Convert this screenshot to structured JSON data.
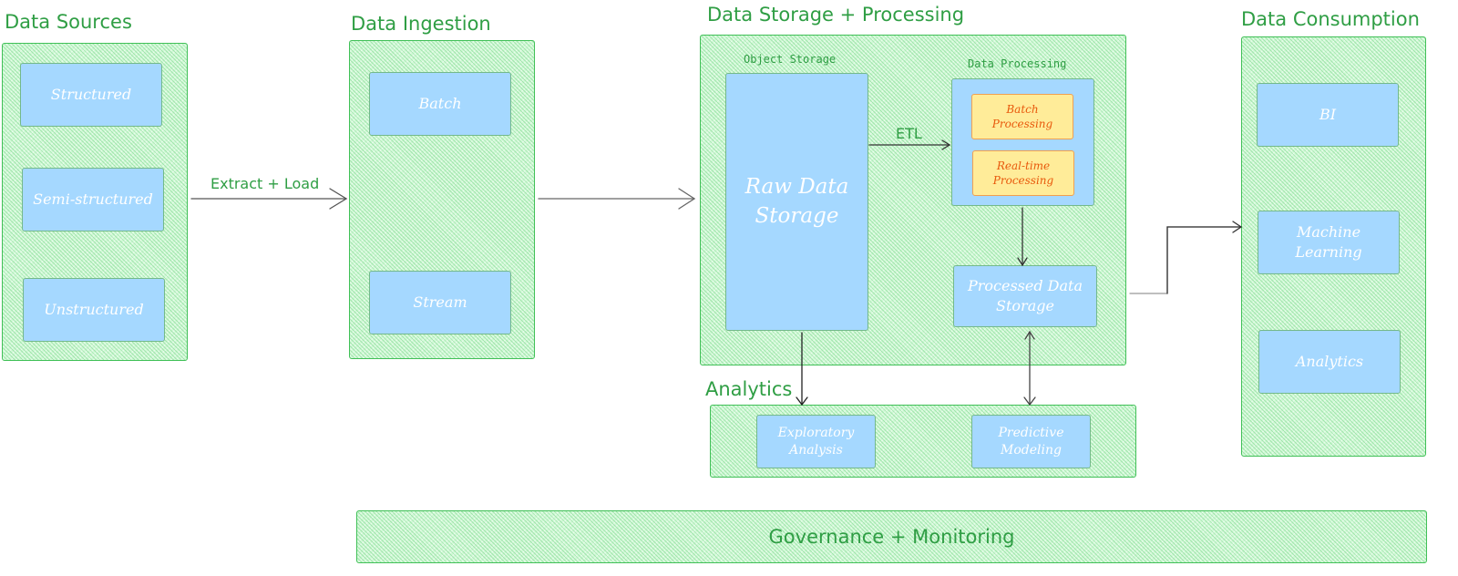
{
  "sections": {
    "sources": {
      "title": "Data Sources",
      "items": [
        "Structured",
        "Semi-structured",
        "Unstructured"
      ]
    },
    "ingestion": {
      "title": "Data Ingestion",
      "items": [
        "Batch",
        "Stream"
      ]
    },
    "storage": {
      "title": "Data Storage + Processing",
      "object_storage_label": "Object Storage",
      "raw_storage": "Raw Data\nStorage",
      "processing_label": "Data Processing",
      "processing_items": [
        "Batch\nProcessing",
        "Real-time\nProcessing"
      ],
      "processed_storage": "Processed Data\nStorage"
    },
    "analytics": {
      "title": "Analytics",
      "items": [
        "Exploratory\nAnalysis",
        "Predictive\nModeling"
      ]
    },
    "consumption": {
      "title": "Data Consumption",
      "items": [
        "BI",
        "Machine\nLearning",
        "Analytics"
      ]
    },
    "governance": {
      "title": "Governance + Monitoring"
    }
  },
  "edges": {
    "extract_load_label": "Extract + Load",
    "etl_label": "ETL"
  },
  "colors": {
    "group_border": "#40c057",
    "group_fill": "#d3f9d8",
    "title_text": "#2f9e44",
    "node_fill": "#a5d8ff",
    "processing_fill": "#ffec99",
    "processing_text": "#e8590c"
  }
}
